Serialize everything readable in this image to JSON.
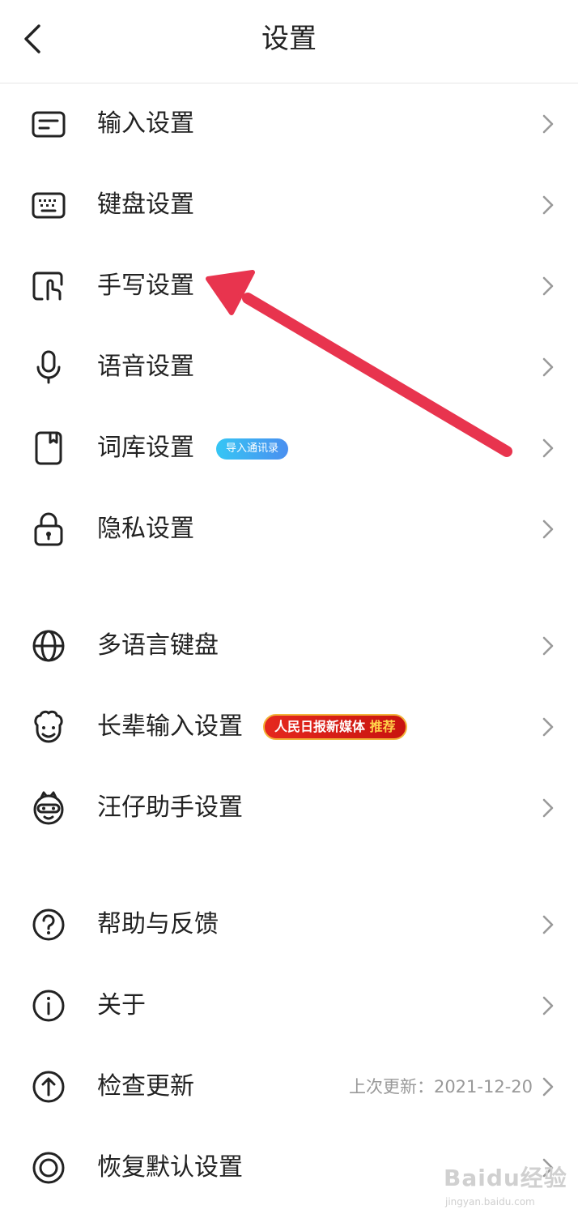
{
  "header": {
    "title": "设置"
  },
  "items": [
    {
      "label": "输入设置"
    },
    {
      "label": "键盘设置"
    },
    {
      "label": "手写设置"
    },
    {
      "label": "语音设置"
    },
    {
      "label": "词库设置",
      "badge": "导入通讯录"
    },
    {
      "label": "隐私设置"
    },
    {
      "label": "多语言键盘"
    },
    {
      "label": "长辈输入设置",
      "badge_main": "人民日报新媒体",
      "badge_highlight": "推荐"
    },
    {
      "label": "汪仔助手设置"
    },
    {
      "label": "帮助与反馈"
    },
    {
      "label": "关于"
    },
    {
      "label": "检查更新",
      "secondary": "上次更新：2021-12-20"
    },
    {
      "label": "恢复默认设置"
    }
  ],
  "watermark": {
    "logo": "Baidu经验",
    "url": "jingyan.baidu.com"
  },
  "colors": {
    "annotation_arrow": "#e8344e",
    "badge_blue_start": "#36c6f4",
    "badge_blue_end": "#4a8ff0",
    "badge_red": "#e5281e",
    "badge_red_highlight": "#ffd24a",
    "secondary_text": "#999999",
    "chevron": "#9a9a9a"
  },
  "icons": [
    "back-chevron",
    "input-box",
    "keyboard",
    "handwriting-finger",
    "microphone",
    "book",
    "lock",
    "globe",
    "elder-face",
    "wangzai-face",
    "question-circle",
    "info-circle",
    "up-arrow-circle",
    "restore-circle",
    "chevron-right"
  ]
}
